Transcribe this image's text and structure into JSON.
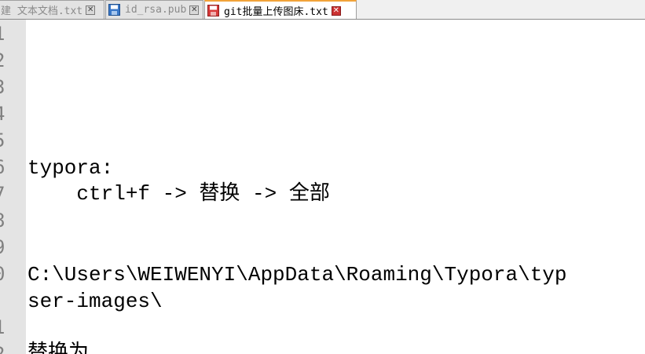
{
  "tabs": [
    {
      "label": "建 文本文档.txt",
      "icon": "file-icon",
      "active": false
    },
    {
      "label": "id_rsa.pub",
      "icon": "save-icon",
      "active": false
    },
    {
      "label": "git批量上传图床.txt",
      "icon": "save-icon-red",
      "active": true
    }
  ],
  "close_glyph": "✕",
  "gutter": {
    "numbers": [
      "1",
      "2",
      "3",
      "4",
      "5",
      "6",
      "7",
      "8",
      "9",
      "0",
      "1",
      "2"
    ]
  },
  "lines": [
    "typora:",
    "    ctrl+f -> 替换 -> 全部",
    "C:\\Users\\WEIWENYI\\AppData\\Roaming\\Typora\\typ",
    "ser-images\\",
    "替换为"
  ],
  "colors": {
    "active_tab_accent": "#f2a33a",
    "close_active": "#cc3333",
    "gutter_bg": "#e4e4e4",
    "line_number_text": "#808080"
  }
}
